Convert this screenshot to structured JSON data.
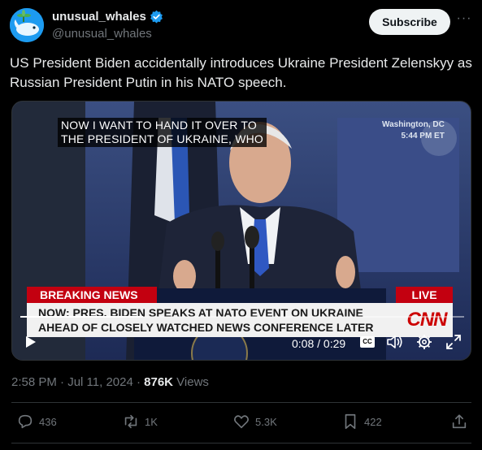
{
  "account": {
    "display_name": "unusual_whales",
    "handle": "@unusual_whales",
    "subscribe_label": "Subscribe",
    "more_icon": "more-icon"
  },
  "tweet": {
    "text": "US President Biden accidentally introduces Ukraine President Zelenskyy as Russian President Putin in his NATO speech."
  },
  "video": {
    "caption_line1": "NOW I WANT TO HAND IT OVER TO",
    "caption_line2": "THE PRESIDENT OF UKRAINE, WHO",
    "location": "Washington, DC",
    "local_time": "5:44 PM ET",
    "breaking_label": "BREAKING NEWS",
    "live_label": "LIVE",
    "chyron_line1": "NOW: PRES. BIDEN SPEAKS AT NATO EVENT ON UKRAINE",
    "chyron_line2": "AHEAD OF CLOSELY WATCHED NEWS CONFERENCE LATER",
    "network_logo": "CNN",
    "time_display": "0:08 / 0:29",
    "progress_fraction": 0.276,
    "cc_label": "CC"
  },
  "meta": {
    "time": "2:58 PM · Jul 11, 2024 · ",
    "views_count": "876K",
    "views_label": " Views"
  },
  "actions": {
    "replies": "436",
    "reposts": "1K",
    "likes": "5.3K",
    "bookmarks": "422"
  },
  "colors": {
    "verified": "#1d9bf0",
    "breaking_red": "#c30010",
    "cnn_red": "#cc0000"
  }
}
